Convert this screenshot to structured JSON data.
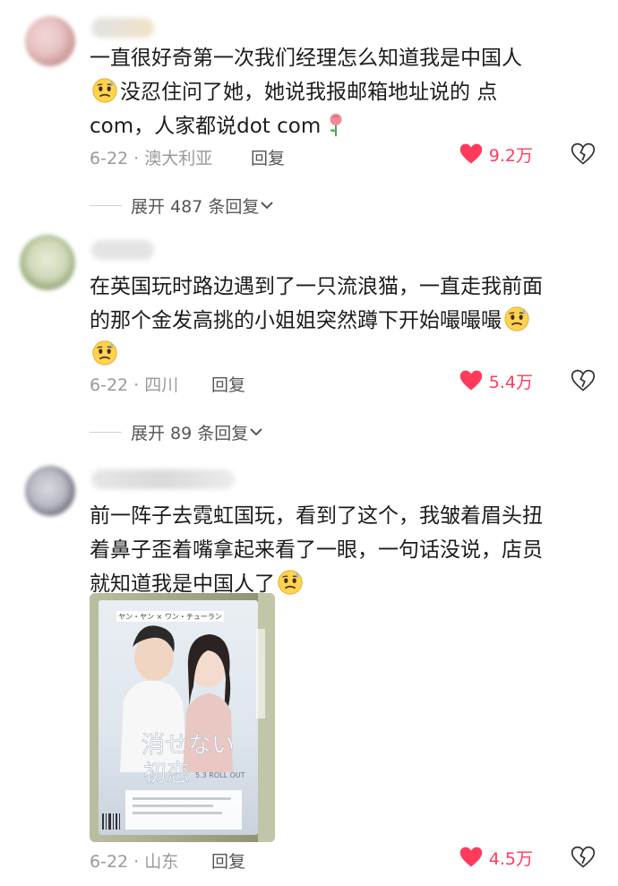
{
  "comments": [
    {
      "text_a": "一直很好奇第一次我们经理怎么知道我是中国人",
      "text_b": "没忍住问了她，她说我报邮箱地址说的 点",
      "text_c": "com，人家都说dot com",
      "date_location": "6-22 · 澳大利亚",
      "reply_label": "回复",
      "likes": "9.2万"
    },
    {
      "text_a": "在英国玩时路边遇到了一只流浪猫，一直走我前面",
      "text_b": "的那个金发高挑的小姐姐突然蹲下开始嘬嘬嘬",
      "date_location": "6-22 · 四川",
      "reply_label": "回复",
      "likes": "5.4万"
    },
    {
      "text_a": "前一阵子去霓虹国玩，看到了这个，我皱着眉头扭",
      "text_b": "着鼻子歪着嘴拿起来看了一眼，一句话没说，店员",
      "text_c": "就知道我是中国人了",
      "poster": {
        "top_caption": "ヤン・ヤン × ワン・チューラン",
        "title_line1": "消せない",
        "title_line2": "初恋",
        "release": "5.3 ROLL OUT"
      },
      "date_location": "6-22 · 山东",
      "reply_label": "回复",
      "likes": "4.5万"
    }
  ],
  "expand": [
    {
      "label": "展开 487 条回复"
    },
    {
      "label": "展开 89 条回复"
    }
  ],
  "colors": {
    "like": "#ff3b5c",
    "meta": "#9a9a9a",
    "text": "#1c1c1c"
  },
  "icons": [
    "heart-icon",
    "broken-heart-icon",
    "chevron-down-icon",
    "sweat-face-emoji",
    "rose-emoji"
  ]
}
